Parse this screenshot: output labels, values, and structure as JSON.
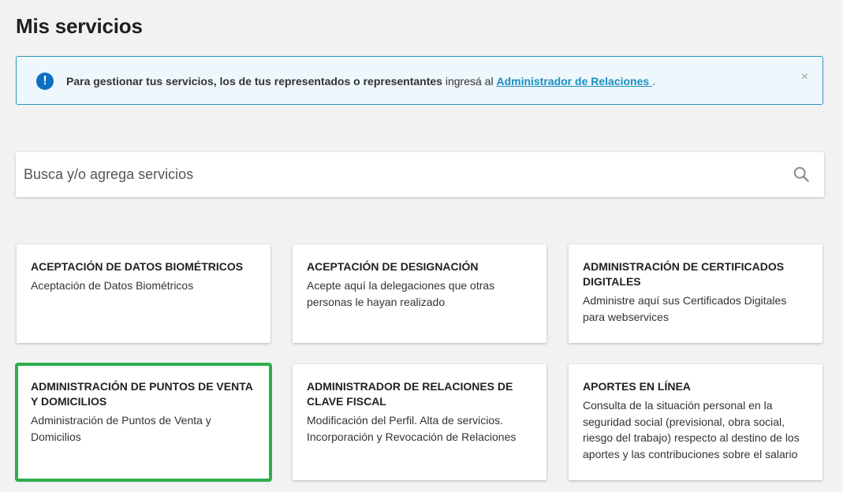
{
  "page": {
    "title": "Mis servicios"
  },
  "alert": {
    "icon": "exclamation-circle-icon",
    "bold_text": "Para gestionar tus servicios, los de tus representados o representantes",
    "normal_text": " ingresá al ",
    "link_text": "Administrador de Relaciones ",
    "suffix": ".",
    "close_symbol": "×",
    "accent_color": "#0b6fc4",
    "border_color": "#2a97b8"
  },
  "search": {
    "placeholder": "Busca y/o agrega servicios",
    "icon": "search-icon"
  },
  "services": [
    {
      "title": "ACEPTACIÓN DE DATOS BIOMÉTRICOS",
      "description": "Aceptación de Datos Biométricos"
    },
    {
      "title": "ACEPTACIÓN DE DESIGNACIÓN",
      "description": "Acepte aquí la delegaciones que otras personas le hayan realizado"
    },
    {
      "title": "ADMINISTRACIÓN DE CERTIFICADOS DIGITALES",
      "description": "Administre aquí sus Certificados Digitales para webservices"
    },
    {
      "title": "ADMINISTRACIÓN DE PUNTOS DE VENTA Y DOMICILIOS",
      "description": "Administración de Puntos de Venta y Domicilios",
      "highlighted": true
    },
    {
      "title": "ADMINISTRADOR DE RELACIONES DE CLAVE FISCAL",
      "description": "Modificación del Perfil. Alta de servicios. Incorporación y Revocación de Relaciones"
    },
    {
      "title": "APORTES EN LÍNEA",
      "description": "Consulta de la situación personal en la seguridad social (previsional, obra social, riesgo del trabajo) respecto al destino de los aportes y las contribuciones sobre el salario"
    }
  ],
  "highlight_color": "#2fae4b"
}
